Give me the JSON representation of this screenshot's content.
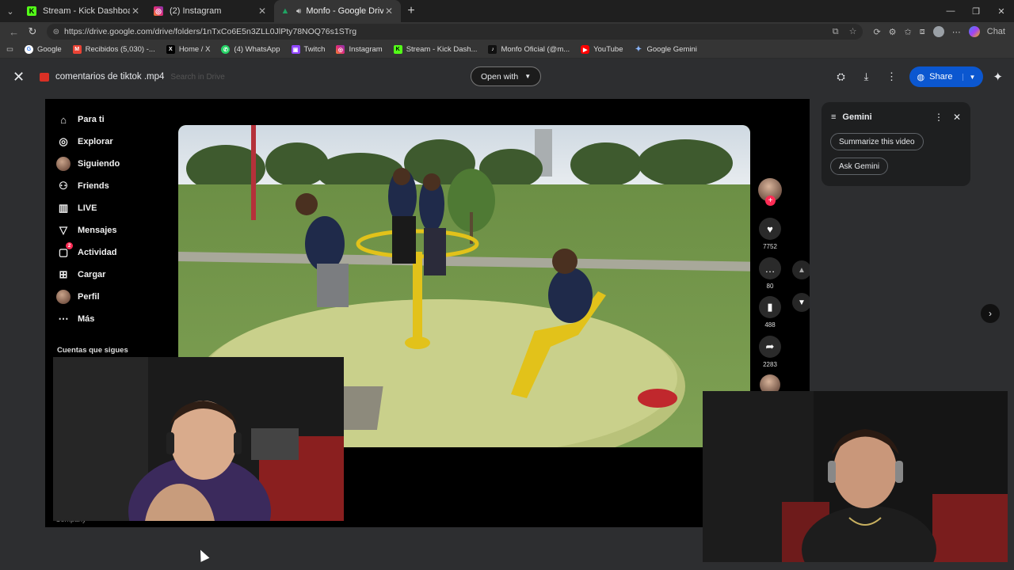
{
  "browser": {
    "tabs": [
      {
        "label": "Stream - Kick Dashboard",
        "icon": "kick-icon",
        "color": "#53fc18"
      },
      {
        "label": "(2) Instagram",
        "icon": "instagram-icon",
        "color": "#e1306c"
      },
      {
        "label": "Monfo - Google Drive",
        "icon": "google-drive-icon",
        "color": "#1fa463"
      }
    ],
    "url": "https://drive.google.com/drive/folders/1nTxCo6E5n3ZLL0JlPty78NOQ76s1STrg",
    "chat_label": "Chat",
    "bookmarks": [
      {
        "label": "Google",
        "icon": "google-icon",
        "color": "#4285f4"
      },
      {
        "label": "Recibidos (5,030) -...",
        "icon": "gmail-icon",
        "color": "#ea4335"
      },
      {
        "label": "Home / X",
        "icon": "x-icon",
        "color": "#000000"
      },
      {
        "label": "(4) WhatsApp",
        "icon": "whatsapp-icon",
        "color": "#25d366"
      },
      {
        "label": "Twitch",
        "icon": "twitch-icon",
        "color": "#9146ff"
      },
      {
        "label": "Instagram",
        "icon": "instagram-icon",
        "color": "#e1306c"
      },
      {
        "label": "Stream - Kick Dash...",
        "icon": "kick-icon",
        "color": "#53fc18"
      },
      {
        "label": "Monfo Oficial (@m...",
        "icon": "tiktok-icon",
        "color": "#111111"
      },
      {
        "label": "YouTube",
        "icon": "youtube-icon",
        "color": "#ff0000"
      },
      {
        "label": "Google Gemini",
        "icon": "gemini-icon",
        "color": "#8ab4f8"
      }
    ]
  },
  "viewer": {
    "file_name": "comentarios de tiktok .mp4",
    "ghost_search": "Search in Drive",
    "open_with": "Open with",
    "share": "Share"
  },
  "tiktok": {
    "nav": [
      {
        "label": "Para ti",
        "icon": "home-icon"
      },
      {
        "label": "Explorar",
        "icon": "compass-icon"
      },
      {
        "label": "Siguiendo",
        "icon": "avatar-icon"
      },
      {
        "label": "Friends",
        "icon": "friends-icon"
      },
      {
        "label": "LIVE",
        "icon": "live-icon"
      },
      {
        "label": "Mensajes",
        "icon": "messages-icon"
      },
      {
        "label": "Actividad",
        "icon": "activity-icon",
        "badge": "2"
      },
      {
        "label": "Cargar",
        "icon": "upload-icon"
      },
      {
        "label": "Perfil",
        "icon": "avatar-icon"
      },
      {
        "label": "Más",
        "icon": "more-icon"
      }
    ],
    "following_title": "Cuentas que sigues",
    "company": "Company",
    "likes": "7752",
    "comments": "80",
    "saves": "488",
    "shares": "2283"
  },
  "gemini": {
    "title": "Gemini",
    "chip_summarize": "Summarize this video",
    "chip_ask": "Ask Gemini"
  }
}
